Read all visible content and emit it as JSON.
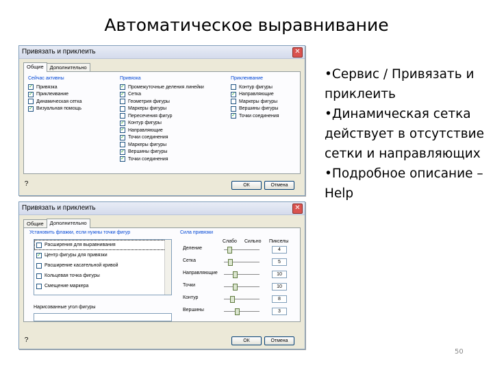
{
  "slide": {
    "title": "Автоматическое выравнивание",
    "page_number": "50",
    "bullets": [
      "•Сервис / Привязать и приклеить",
      "•Динамическая сетка действует в отсутствие сетки и направляющих",
      "•Подробное описание – Help"
    ]
  },
  "dialog1": {
    "title": "Привязать и приклеить",
    "close_glyph": "✕",
    "tabs": [
      "Общие",
      "Дополнительно"
    ],
    "col1": {
      "heading": "Сейчас активны",
      "items": [
        {
          "label": "Привязка",
          "checked": true
        },
        {
          "label": "Приклеивание",
          "checked": true
        },
        {
          "label": "Динамическая сетка",
          "checked": false
        },
        {
          "label": "Визуальная помощь",
          "checked": true
        }
      ]
    },
    "col2": {
      "heading": "Привязка",
      "items": [
        {
          "label": "Промежуточные деления линейки",
          "checked": true
        },
        {
          "label": "Сетка",
          "checked": true
        },
        {
          "label": "Геометрия фигуры",
          "checked": false
        },
        {
          "label": "Маркеры фигуры",
          "checked": false
        },
        {
          "label": "Пересечения фигур",
          "checked": false
        },
        {
          "label": "Контур фигуры",
          "checked": true
        },
        {
          "label": "Направляющие",
          "checked": true
        },
        {
          "label": "Точки соединения",
          "checked": true
        },
        {
          "label": "Маркеры фигуры",
          "checked": false
        },
        {
          "label": "Вершины фигуры",
          "checked": true
        },
        {
          "label": "Точки соединения",
          "checked": true
        }
      ]
    },
    "col3": {
      "heading": "Приклеивание",
      "items": [
        {
          "label": "Контур фигуры",
          "checked": false
        },
        {
          "label": "Направляющие",
          "checked": true
        },
        {
          "label": "Маркеры фигуры",
          "checked": false
        },
        {
          "label": "Вершины фигуры",
          "checked": false
        },
        {
          "label": "Точки соединения",
          "checked": true
        }
      ]
    },
    "ok": "ОК",
    "cancel": "Отмена"
  },
  "dialog2": {
    "title": "Привязать и приклеить",
    "close_glyph": "✕",
    "tabs": [
      "Общие",
      "Дополнительно"
    ],
    "list_heading": "Установить флажки, если нужны точки фигур",
    "list_items": [
      {
        "label": "Расширения для выравнивания",
        "checked": false
      },
      {
        "label": "Центр фигуры для привязки",
        "checked": true
      },
      {
        "label": "Расширение касательной кривой",
        "checked": false
      },
      {
        "label": "Кольцевая точка фигуры",
        "checked": false
      },
      {
        "label": "Смещение маркера",
        "checked": false
      }
    ],
    "field_label": "Нарисованные угол фигуры",
    "strength_heading": "Сила привязки",
    "scale_labels": [
      "Слабо",
      "Сильно",
      "Пикселы"
    ],
    "sliders": [
      {
        "label": "Деление",
        "value": "4",
        "level": 0.1
      },
      {
        "label": "Сетка",
        "value": "5",
        "level": 0.12
      },
      {
        "label": "Направляющие",
        "value": "10",
        "level": 0.25
      },
      {
        "label": "Точки",
        "value": "10",
        "level": 0.25
      },
      {
        "label": "Контур",
        "value": "8",
        "level": 0.18
      },
      {
        "label": "Вершины",
        "value": "3",
        "level": 0.3
      }
    ],
    "ok": "ОК",
    "cancel": "Отмена"
  }
}
